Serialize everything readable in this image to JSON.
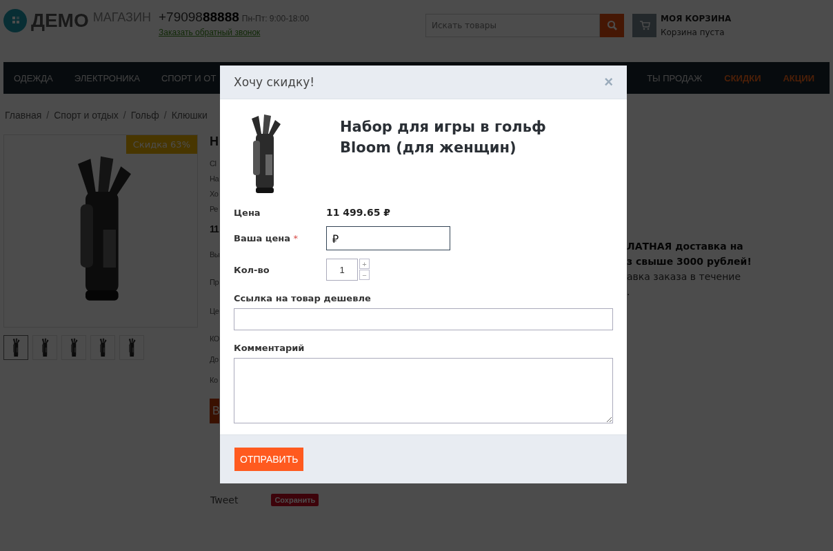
{
  "header": {
    "logo": {
      "main": "ДЕМО",
      "sub": "МАГАЗИН"
    },
    "phone": {
      "prefix": "+79098",
      "bold": "88888",
      "hours": "Пн-Пт: 9:00-18:00"
    },
    "callback_link": "Заказать обратный звонок",
    "search": {
      "placeholder": "Искать товары"
    },
    "cart": {
      "title": "МОЯ КОРЗИНА",
      "status": "Корзина пуста"
    }
  },
  "nav": {
    "items": [
      {
        "label": "ОДЕЖДА",
        "kind": "regular"
      },
      {
        "label": "ЭЛЕКТРОНИКА",
        "kind": "regular"
      },
      {
        "label": "СПОРТ И ОТ",
        "kind": "regular"
      }
    ],
    "right_items": [
      {
        "label": "ТЫ ПРОДАЖ",
        "kind": "regular"
      },
      {
        "label": "СКИДКИ",
        "kind": "promo"
      },
      {
        "label": "АКЦИИ",
        "kind": "promo"
      }
    ]
  },
  "breadcrumb": [
    {
      "label": "Главная",
      "kind": "link"
    },
    {
      "label": "/",
      "kind": "separator"
    },
    {
      "label": "Спорт и отдых",
      "kind": "link"
    },
    {
      "label": "/",
      "kind": "separator"
    },
    {
      "label": "Гольф",
      "kind": "link"
    },
    {
      "label": "/",
      "kind": "separator"
    },
    {
      "label": "Клюшки",
      "kind": "link"
    }
  ],
  "product": {
    "badge": "Скидка 63%",
    "thumbnails": [
      {
        "selected": true
      },
      {
        "selected": false
      },
      {
        "selected": false
      },
      {
        "selected": false
      },
      {
        "selected": false
      }
    ],
    "title_fragment": "Н",
    "lines": [
      "Cl",
      "На",
      "Хо",
      "Ре"
    ],
    "price_fragment": "11",
    "lines2": [
      "Вы",
      "Пр",
      "Це",
      "КО",
      "До",
      "Ко"
    ],
    "button_fragment": "В",
    "tweet": "Tweet",
    "pin_button": "Сохранить"
  },
  "delivery": {
    "bold_lines": [
      "ЛАТНАЯ доставка на",
      "з свыше 3000 рублей!"
    ],
    "lines": [
      "авка заказа в течение",
      "."
    ]
  },
  "modal": {
    "title": "Хочу скидку!",
    "close": "×",
    "product_title": "Набор для игры в гольф Bloom (для женщин)",
    "price_label": "Цена",
    "price": "11 499.65 ₽",
    "your_price": {
      "label": "Ваша цена",
      "required_mark": "*",
      "value": "₽"
    },
    "quantity": {
      "label": "Кол-во",
      "value": "1",
      "plus": "+",
      "minus": "−"
    },
    "link_field": {
      "label": "Ссылка на товар дешевле"
    },
    "comment_field": {
      "label": "Комментарий"
    },
    "submit": "ОТПРАВИТЬ"
  }
}
